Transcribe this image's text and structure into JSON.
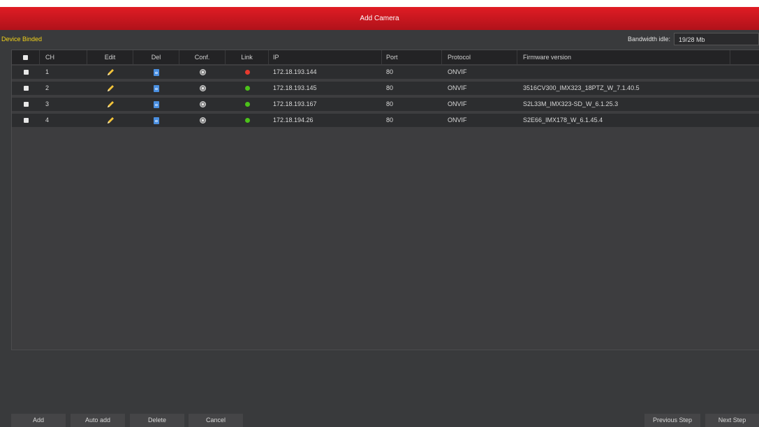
{
  "window": {
    "title": "Add Camera"
  },
  "section_label": "Device Binded",
  "bandwidth": {
    "label": "Bandwidth idle:",
    "value": "19/28 Mb"
  },
  "table": {
    "headers": {
      "ch": "CH",
      "edit": "Edit",
      "del": "Del",
      "conf": "Conf.",
      "link": "Link",
      "ip": "IP",
      "port": "Port",
      "protocol": "Protocol",
      "firmware": "Firmware version"
    },
    "rows": [
      {
        "ch": "1",
        "link_color": "#e63a2e",
        "ip": "172.18.193.144",
        "port": "80",
        "protocol": "ONVIF",
        "firmware": ""
      },
      {
        "ch": "2",
        "link_color": "#4cc21a",
        "ip": "172.18.193.145",
        "port": "80",
        "protocol": "ONVIF",
        "firmware": "3516CV300_IMX323_18PTZ_W_7.1.40.5"
      },
      {
        "ch": "3",
        "link_color": "#4cc21a",
        "ip": "172.18.193.167",
        "port": "80",
        "protocol": "ONVIF",
        "firmware": "S2L33M_IMX323-SD_W_6.1.25.3"
      },
      {
        "ch": "4",
        "link_color": "#4cc21a",
        "ip": "172.18.194.26",
        "port": "80",
        "protocol": "ONVIF",
        "firmware": "S2E66_IMX178_W_6.1.45.4"
      }
    ]
  },
  "buttons": {
    "add": "Add",
    "auto_add": "Auto add",
    "delete": "Delete",
    "cancel": "Cancel",
    "previous": "Previous Step",
    "next": "Next Step"
  },
  "icons": {
    "edit": "pencil-icon",
    "del": "trash-icon",
    "conf": "gear-icon",
    "link": "status-dot-icon"
  },
  "colors": {
    "title_bar": "#c8161e",
    "section_label": "#f2d21a",
    "background": "#393a3c",
    "link_ok": "#4cc21a",
    "link_error": "#e63a2e"
  }
}
